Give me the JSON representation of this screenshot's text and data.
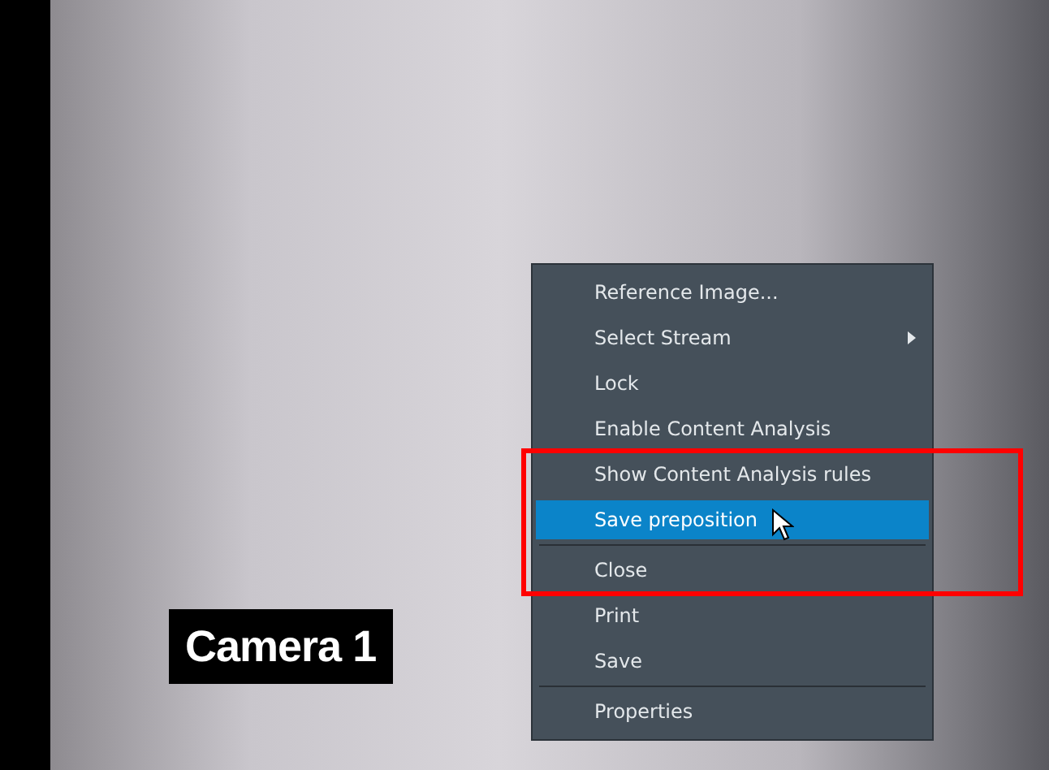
{
  "video": {
    "camera_label": "Camera 1"
  },
  "context_menu": {
    "items": [
      {
        "label": "Reference Image...",
        "kind": "item",
        "selected": false,
        "separator_after": false
      },
      {
        "label": "Select Stream",
        "kind": "submenu",
        "selected": false,
        "separator_after": false
      },
      {
        "label": "Lock",
        "kind": "item",
        "selected": false,
        "separator_after": false
      },
      {
        "label": "Enable Content Analysis",
        "kind": "item",
        "selected": false,
        "separator_after": false
      },
      {
        "label": "Show Content Analysis rules",
        "kind": "item",
        "selected": false,
        "separator_after": false
      },
      {
        "label": "Save preposition",
        "kind": "item",
        "selected": true,
        "separator_after": true
      },
      {
        "label": "Close",
        "kind": "item",
        "selected": false,
        "separator_after": false
      },
      {
        "label": "Print",
        "kind": "item",
        "selected": false,
        "separator_after": false
      },
      {
        "label": "Save",
        "kind": "item",
        "selected": false,
        "separator_after": true
      },
      {
        "label": "Properties",
        "kind": "item",
        "selected": false,
        "separator_after": false
      }
    ]
  }
}
